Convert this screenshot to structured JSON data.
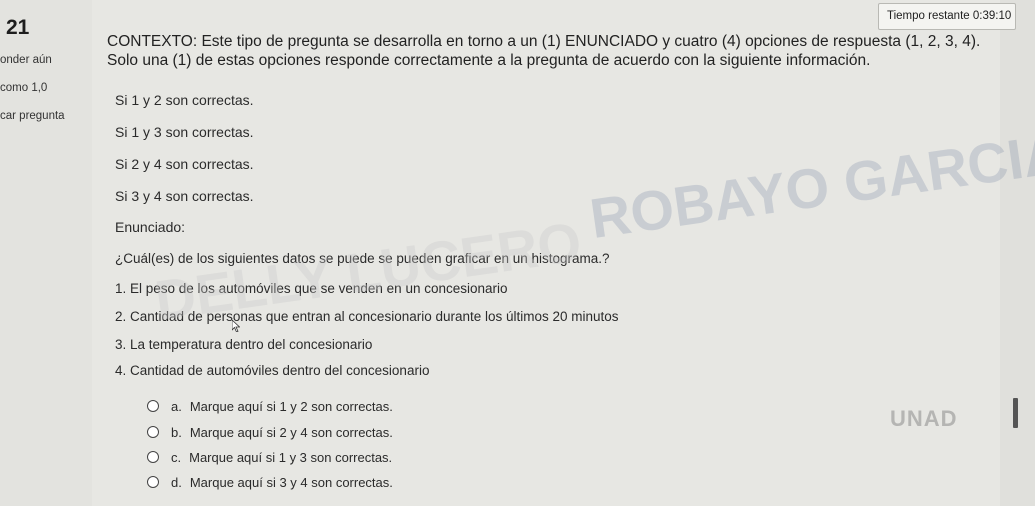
{
  "question_number": "21",
  "timer": {
    "label": "Tiempo restante",
    "value": "0:39:10"
  },
  "sidebar": {
    "lines": [
      "onder aún",
      "como 1,0",
      "car pregunta"
    ]
  },
  "context": "CONTEXTO: Este tipo de pregunta se desarrolla en torno a un (1) ENUNCIADO y cuatro (4) opciones de respuesta (1, 2, 3, 4). Solo una (1) de estas opciones responde correctamente a la pregunta de acuerdo con la siguiente información.",
  "rules": [
    "Si 1 y 2 son correctas.",
    "Si 1 y 3 son correctas.",
    "Si 2 y 4 son correctas.",
    "Si 3 y 4 son correctas."
  ],
  "enunciado_label": "Enunciado:",
  "question": "¿Cuál(es) de los siguientes datos se puede se pueden graficar en un histograma.?",
  "items": [
    "1. El peso de los automóviles que se venden en un concesionario",
    "2. Cantidad de personas que entran al concesionario durante los últimos 20 minutos",
    "3. La temperatura dentro del concesionario",
    "4. Cantidad de automóviles dentro del concesionario"
  ],
  "answers": [
    {
      "letter": "a.",
      "text": "Marque aquí si 1 y 2 son correctas."
    },
    {
      "letter": "b.",
      "text": "Marque aquí si 2 y 4 son correctas."
    },
    {
      "letter": "c.",
      "text": "Marque aquí si 1 y 3 son correctas."
    },
    {
      "letter": "d.",
      "text": "Marque aquí si 3 y 4 son correctas."
    }
  ],
  "watermark": [
    "ROBAYO GARCIA",
    "DELLY LUCERO"
  ],
  "logo": "UNAD",
  "colors": {
    "background": "#e7e7e3",
    "watermark": "#5f7396"
  }
}
